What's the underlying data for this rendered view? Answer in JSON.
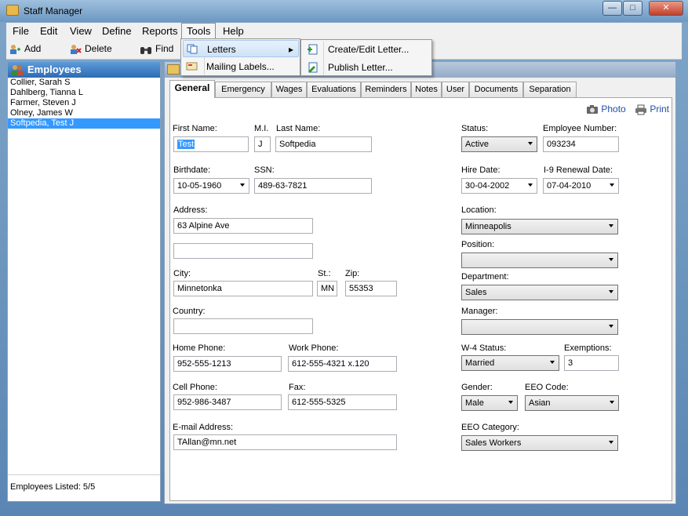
{
  "window": {
    "title": "Staff Manager",
    "min": "0",
    "max": "1",
    "close": "r"
  },
  "menu": {
    "file": "File",
    "edit": "Edit",
    "view": "View",
    "define": "Define",
    "reports": "Reports",
    "tools": "Tools",
    "help": "Help"
  },
  "toolbar": {
    "add": "Add",
    "delete": "Delete",
    "find": "Find"
  },
  "tools_menu": {
    "letters": "Letters",
    "mailing_labels": "Mailing Labels..."
  },
  "letters_submenu": {
    "create_edit": "Create/Edit Letter...",
    "publish": "Publish Letter..."
  },
  "employees": {
    "header": "Employees",
    "list": [
      "Collier, Sarah S",
      "Dahlberg, Tianna L",
      "Farmer, Steven J",
      "Olney, James W",
      "Softpedia, Test J"
    ],
    "footer": "Employees Listed: 5/5"
  },
  "tabs": [
    "General",
    "Emergency",
    "Wages",
    "Evaluations",
    "Reminders",
    "Notes",
    "User",
    "Documents",
    "Separation"
  ],
  "actions": {
    "photo": "Photo",
    "print": "Print"
  },
  "form": {
    "first_name_label": "First Name:",
    "first_name": "Test",
    "mi_label": "M.I.",
    "mi": "J",
    "last_name_label": "Last Name:",
    "last_name": "Softpedia",
    "birthdate_label": "Birthdate:",
    "birthdate": "10-05-1960",
    "ssn_label": "SSN:",
    "ssn": "489-63-7821",
    "address_label": "Address:",
    "address1": "63 Alpine Ave",
    "address2": "",
    "city_label": "City:",
    "city": "Minnetonka",
    "state_label": "St.:",
    "state": "MN",
    "zip_label": "Zip:",
    "zip": "55353",
    "country_label": "Country:",
    "country": "",
    "home_phone_label": "Home Phone:",
    "home_phone": "952-555-1213",
    "work_phone_label": "Work Phone:",
    "work_phone": "612-555-4321 x.120",
    "cell_phone_label": "Cell Phone:",
    "cell_phone": "952-986-3487",
    "fax_label": "Fax:",
    "fax": "612-555-5325",
    "email_label": "E-mail Address:",
    "email": "TAllan@mn.net",
    "status_label": "Status:",
    "status": "Active",
    "emp_number_label": "Employee Number:",
    "emp_number": "093234",
    "hire_date_label": "Hire Date:",
    "hire_date": "30-04-2002",
    "i9_label": "I-9 Renewal Date:",
    "i9_date": "07-04-2010",
    "location_label": "Location:",
    "location": "Minneapolis",
    "position_label": "Position:",
    "position": "",
    "department_label": "Department:",
    "department": "Sales",
    "manager_label": "Manager:",
    "manager": "",
    "w4_label": "W-4 Status:",
    "w4": "Married",
    "exemptions_label": "Exemptions:",
    "exemptions": "3",
    "gender_label": "Gender:",
    "gender": "Male",
    "eeo_code_label": "EEO Code:",
    "eeo_code": "Asian",
    "eeo_category_label": "EEO Category:",
    "eeo_category": "Sales Workers"
  }
}
